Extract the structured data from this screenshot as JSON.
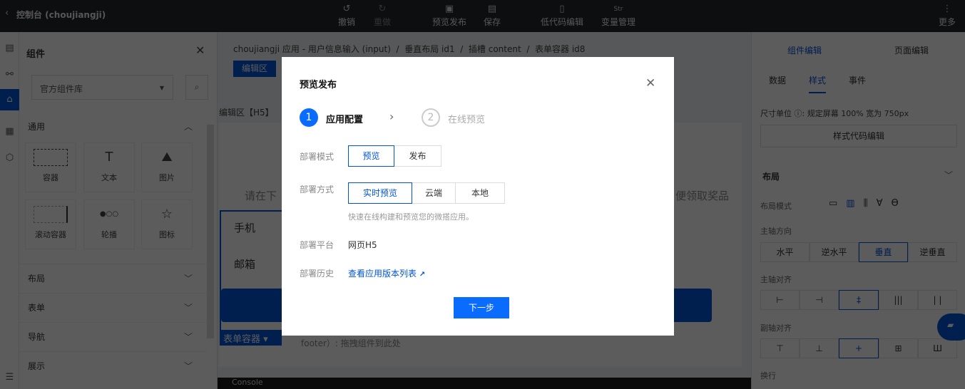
{
  "topbar": {
    "back_title": "控制台 (choujiangji)",
    "undo": "撤销",
    "redo": "重做",
    "preview_publish": "预览发布",
    "save": "保存",
    "lowcode": "低代码编辑",
    "variables": "变量管理",
    "more": "更多",
    "var_icon_text": "Str"
  },
  "components": {
    "title": "组件",
    "library_select": "官方组件库",
    "section_general": "通用",
    "items": [
      {
        "label": "容器",
        "icon": "container-icon"
      },
      {
        "label": "文本",
        "icon": "text-icon"
      },
      {
        "label": "图片",
        "icon": "image-icon"
      },
      {
        "label": "滚动容器",
        "icon": "scroll-container-icon"
      },
      {
        "label": "轮播",
        "icon": "carousel-icon"
      },
      {
        "label": "图标",
        "icon": "star-icon"
      }
    ],
    "sections": [
      "布局",
      "表单",
      "导航",
      "展示"
    ]
  },
  "canvas": {
    "breadcrumb": [
      "choujiangji 应用 - 用户信息输入 (input)",
      "垂直布局 id1",
      "插槽 content",
      "表单容器 id8"
    ],
    "edit_area_button": "编辑区",
    "edit_area_label": "编辑区【H5】",
    "hint_left": "请在下",
    "hint_right": "便领取奖品",
    "field_phone": "手机",
    "field_email": "邮箱",
    "form_container_tag": "表单容器",
    "footer_hint": "footer）: 拖拽组件到此处",
    "console": "Console"
  },
  "right": {
    "tabs": [
      "组件编辑",
      "页面编辑"
    ],
    "subtabs": [
      "数据",
      "样式",
      "事件"
    ],
    "active_subtab": "样式",
    "size_unit": "尺寸单位 ⓘ: 规定屏幕 100% 宽为 750px",
    "style_code_button": "样式代码编辑",
    "layout_title": "布局",
    "layout_mode_label": "布局模式",
    "main_axis_dir_label": "主轴方向",
    "main_axis_dirs": [
      "水平",
      "逆水平",
      "垂直",
      "逆垂直"
    ],
    "active_dir": "垂直",
    "main_align_label": "主轴对齐",
    "cross_align_label": "副轴对齐",
    "wrap_label": "换行"
  },
  "modal": {
    "title": "预览发布",
    "steps": [
      {
        "num": "1",
        "label": "应用配置"
      },
      {
        "num": "2",
        "label": "在线预览"
      }
    ],
    "deploy_mode_label": "部署模式",
    "deploy_modes": [
      "预览",
      "发布"
    ],
    "active_mode": "预览",
    "deploy_method_label": "部署方式",
    "deploy_methods": [
      "实时预览",
      "云端",
      "本地"
    ],
    "active_method": "实时预览",
    "method_hint": "快速在线构建和预览您的微搭应用。",
    "platform_label": "部署平台",
    "platform_value": "网页H5",
    "history_label": "部署历史",
    "history_link": "查看应用版本列表",
    "next_button": "下一步"
  },
  "colors": {
    "primary": "#0052d9",
    "button": "#0a6cff"
  }
}
